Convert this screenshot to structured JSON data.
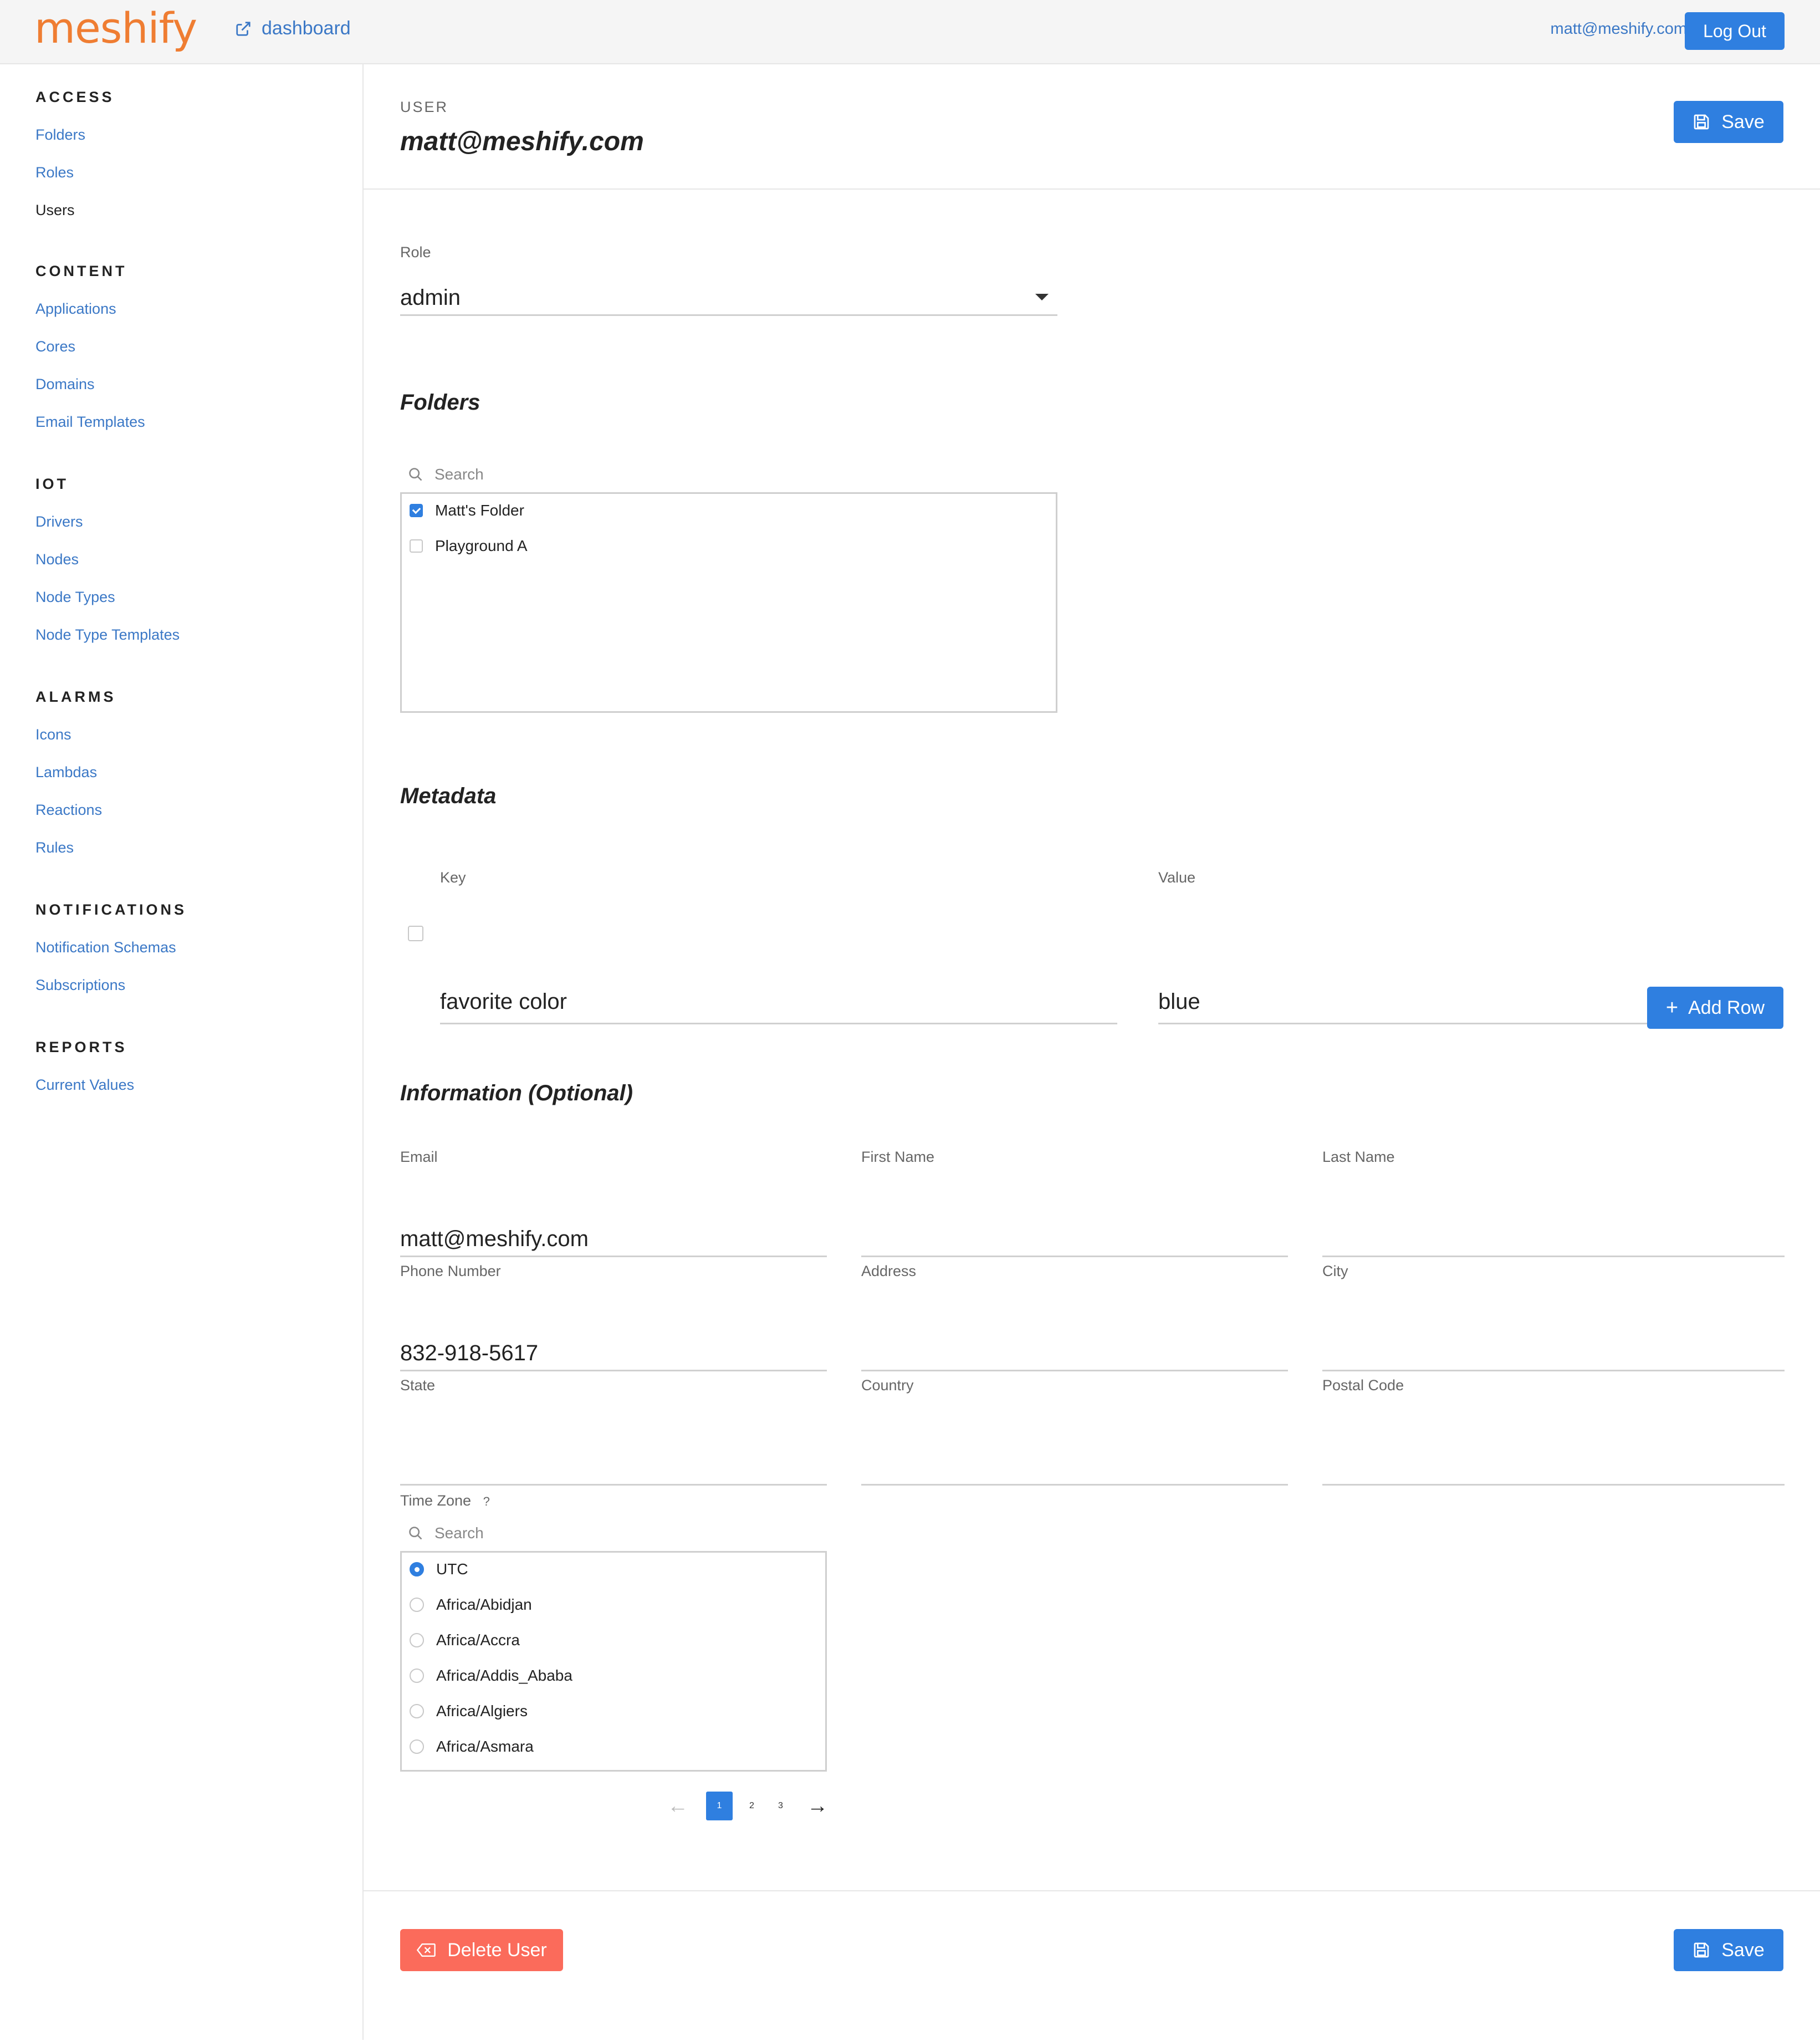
{
  "topbar": {
    "logo": "meshify",
    "dashboard_link": "dashboard",
    "user_email": "matt@meshify.com",
    "logout_label": "Log Out"
  },
  "sidebar": {
    "sections": [
      {
        "title": "ACCESS",
        "items": [
          "Folders",
          "Roles",
          "Users"
        ]
      },
      {
        "title": "CONTENT",
        "items": [
          "Applications",
          "Cores",
          "Domains",
          "Email Templates"
        ]
      },
      {
        "title": "IOT",
        "items": [
          "Drivers",
          "Nodes",
          "Node Types",
          "Node Type Templates"
        ]
      },
      {
        "title": "ALARMS",
        "items": [
          "Icons",
          "Lambdas",
          "Reactions",
          "Rules"
        ]
      },
      {
        "title": "NOTIFICATIONS",
        "items": [
          "Notification Schemas",
          "Subscriptions"
        ]
      },
      {
        "title": "REPORTS",
        "items": [
          "Current Values"
        ]
      }
    ],
    "active_item": "Users"
  },
  "header": {
    "kicker": "USER",
    "title": "matt@meshify.com",
    "save_label": "Save"
  },
  "role": {
    "label": "Role",
    "value": "admin"
  },
  "folders": {
    "title": "Folders",
    "search_placeholder": "Search",
    "items": [
      {
        "label": "Matt's Folder",
        "checked": true
      },
      {
        "label": "Playground A",
        "checked": false
      }
    ]
  },
  "metadata": {
    "title": "Metadata",
    "key_header": "Key",
    "value_header": "Value",
    "rows": [
      {
        "key": "favorite color",
        "value": "blue"
      }
    ],
    "add_row_label": "Add Row"
  },
  "information": {
    "title": "Information (Optional)",
    "fields": [
      {
        "label": "Email",
        "value": "matt@meshify.com"
      },
      {
        "label": "First Name",
        "value": ""
      },
      {
        "label": "Last Name",
        "value": ""
      },
      {
        "label": "Phone Number",
        "value": "832-918-5617"
      },
      {
        "label": "Address",
        "value": ""
      },
      {
        "label": "City",
        "value": ""
      },
      {
        "label": "State",
        "value": ""
      },
      {
        "label": "Country",
        "value": ""
      },
      {
        "label": "Postal Code",
        "value": ""
      }
    ]
  },
  "timezone": {
    "label": "Time Zone",
    "help": "?",
    "search_placeholder": "Search",
    "options": [
      {
        "label": "UTC",
        "selected": true
      },
      {
        "label": "Africa/Abidjan",
        "selected": false
      },
      {
        "label": "Africa/Accra",
        "selected": false
      },
      {
        "label": "Africa/Addis_Ababa",
        "selected": false
      },
      {
        "label": "Africa/Algiers",
        "selected": false
      },
      {
        "label": "Africa/Asmara",
        "selected": false
      }
    ],
    "pagination": {
      "prev": "←",
      "pages": [
        "1",
        "2",
        "3"
      ],
      "current": "1",
      "next": "→"
    }
  },
  "footer": {
    "delete_label": "Delete User",
    "save_label": "Save"
  },
  "colors": {
    "brand": "#ef7d32",
    "primary": "#2f7fe0",
    "link": "#3b78c6",
    "danger": "#fb6b5b"
  }
}
